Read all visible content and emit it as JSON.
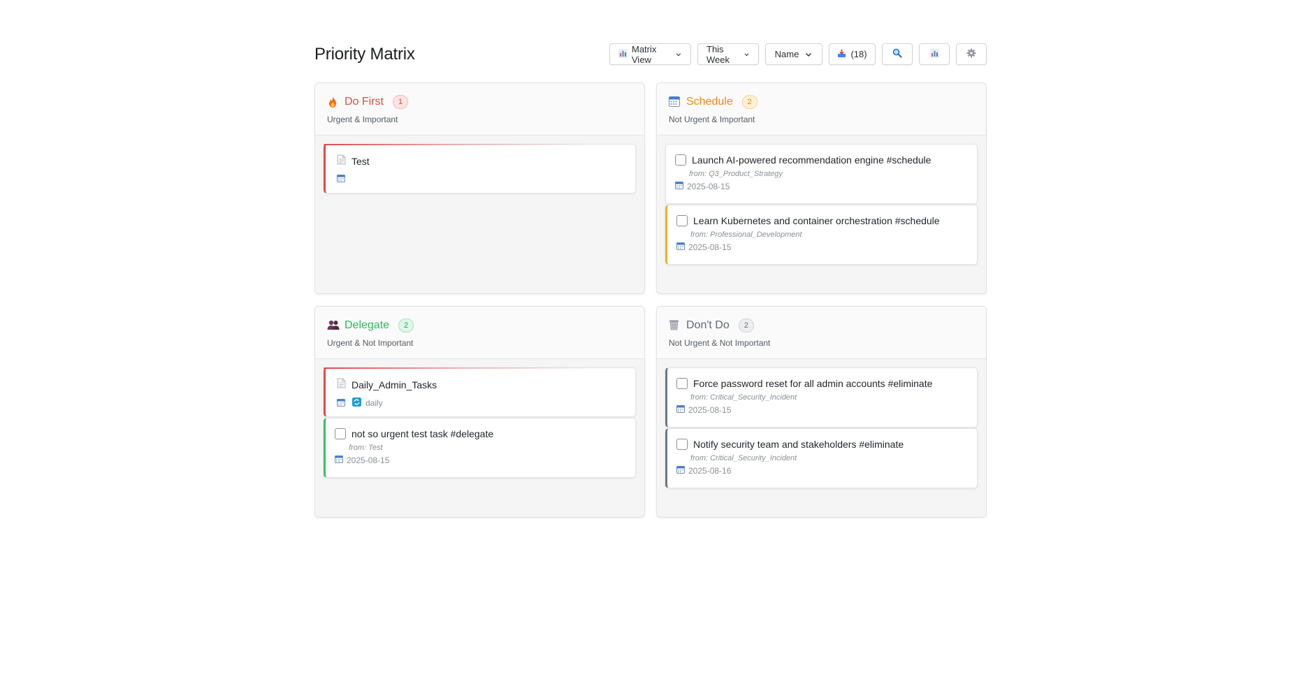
{
  "header": {
    "title": "Priority Matrix",
    "view_select": {
      "icon": "bar-chart-icon",
      "value": "Matrix View"
    },
    "period_select": {
      "value": "This Week"
    },
    "sort_select": {
      "value": "Name"
    },
    "inbox_button": {
      "icon": "inbox-tray-icon",
      "label": "(18)"
    },
    "search_button": {
      "icon": "search-icon"
    },
    "stats_button": {
      "icon": "bar-chart-icon"
    },
    "settings_button": {
      "icon": "gear-icon"
    }
  },
  "colors": {
    "do_first": "#e84a3f",
    "schedule": "#ef8a12",
    "delegate": "#2fb85c",
    "dont_do": "#616a75"
  },
  "quadrants": {
    "do_first": {
      "title": "Do First",
      "count": "1",
      "subtitle": "Urgent & Important",
      "icon": "fire-icon",
      "items": [
        {
          "kind": "note",
          "title": "Test",
          "icon": "document-icon"
        }
      ]
    },
    "schedule": {
      "title": "Schedule",
      "count": "2",
      "subtitle": "Not Urgent & Important",
      "icon": "calendar-icon",
      "items": [
        {
          "kind": "task",
          "title": "Launch AI-powered recommendation engine #schedule",
          "from": "from: Q3_Product_Strategy",
          "date": "2025-08-15"
        },
        {
          "kind": "task",
          "title": "Learn Kubernetes and container orchestration #schedule",
          "from": "from: Professional_Development",
          "date": "2025-08-15"
        }
      ]
    },
    "delegate": {
      "title": "Delegate",
      "count": "2",
      "subtitle": "Urgent & Not Important",
      "icon": "people-icon",
      "items": [
        {
          "kind": "note",
          "title": "Daily_Admin_Tasks",
          "icon": "document-icon",
          "recurrence": "daily"
        },
        {
          "kind": "task",
          "title": "not so urgent test task #delegate",
          "from": "from: Test",
          "date": "2025-08-15"
        }
      ]
    },
    "dont_do": {
      "title": "Don't Do",
      "count": "2",
      "subtitle": "Not Urgent & Not Important",
      "icon": "trash-icon",
      "items": [
        {
          "kind": "task",
          "title": "Force password reset for all admin accounts #eliminate",
          "from": "from: Critical_Security_Incident",
          "date": "2025-08-15"
        },
        {
          "kind": "task",
          "title": "Notify security team and stakeholders #eliminate",
          "from": "from: Critical_Security_Incident",
          "date": "2025-08-16"
        }
      ]
    }
  }
}
